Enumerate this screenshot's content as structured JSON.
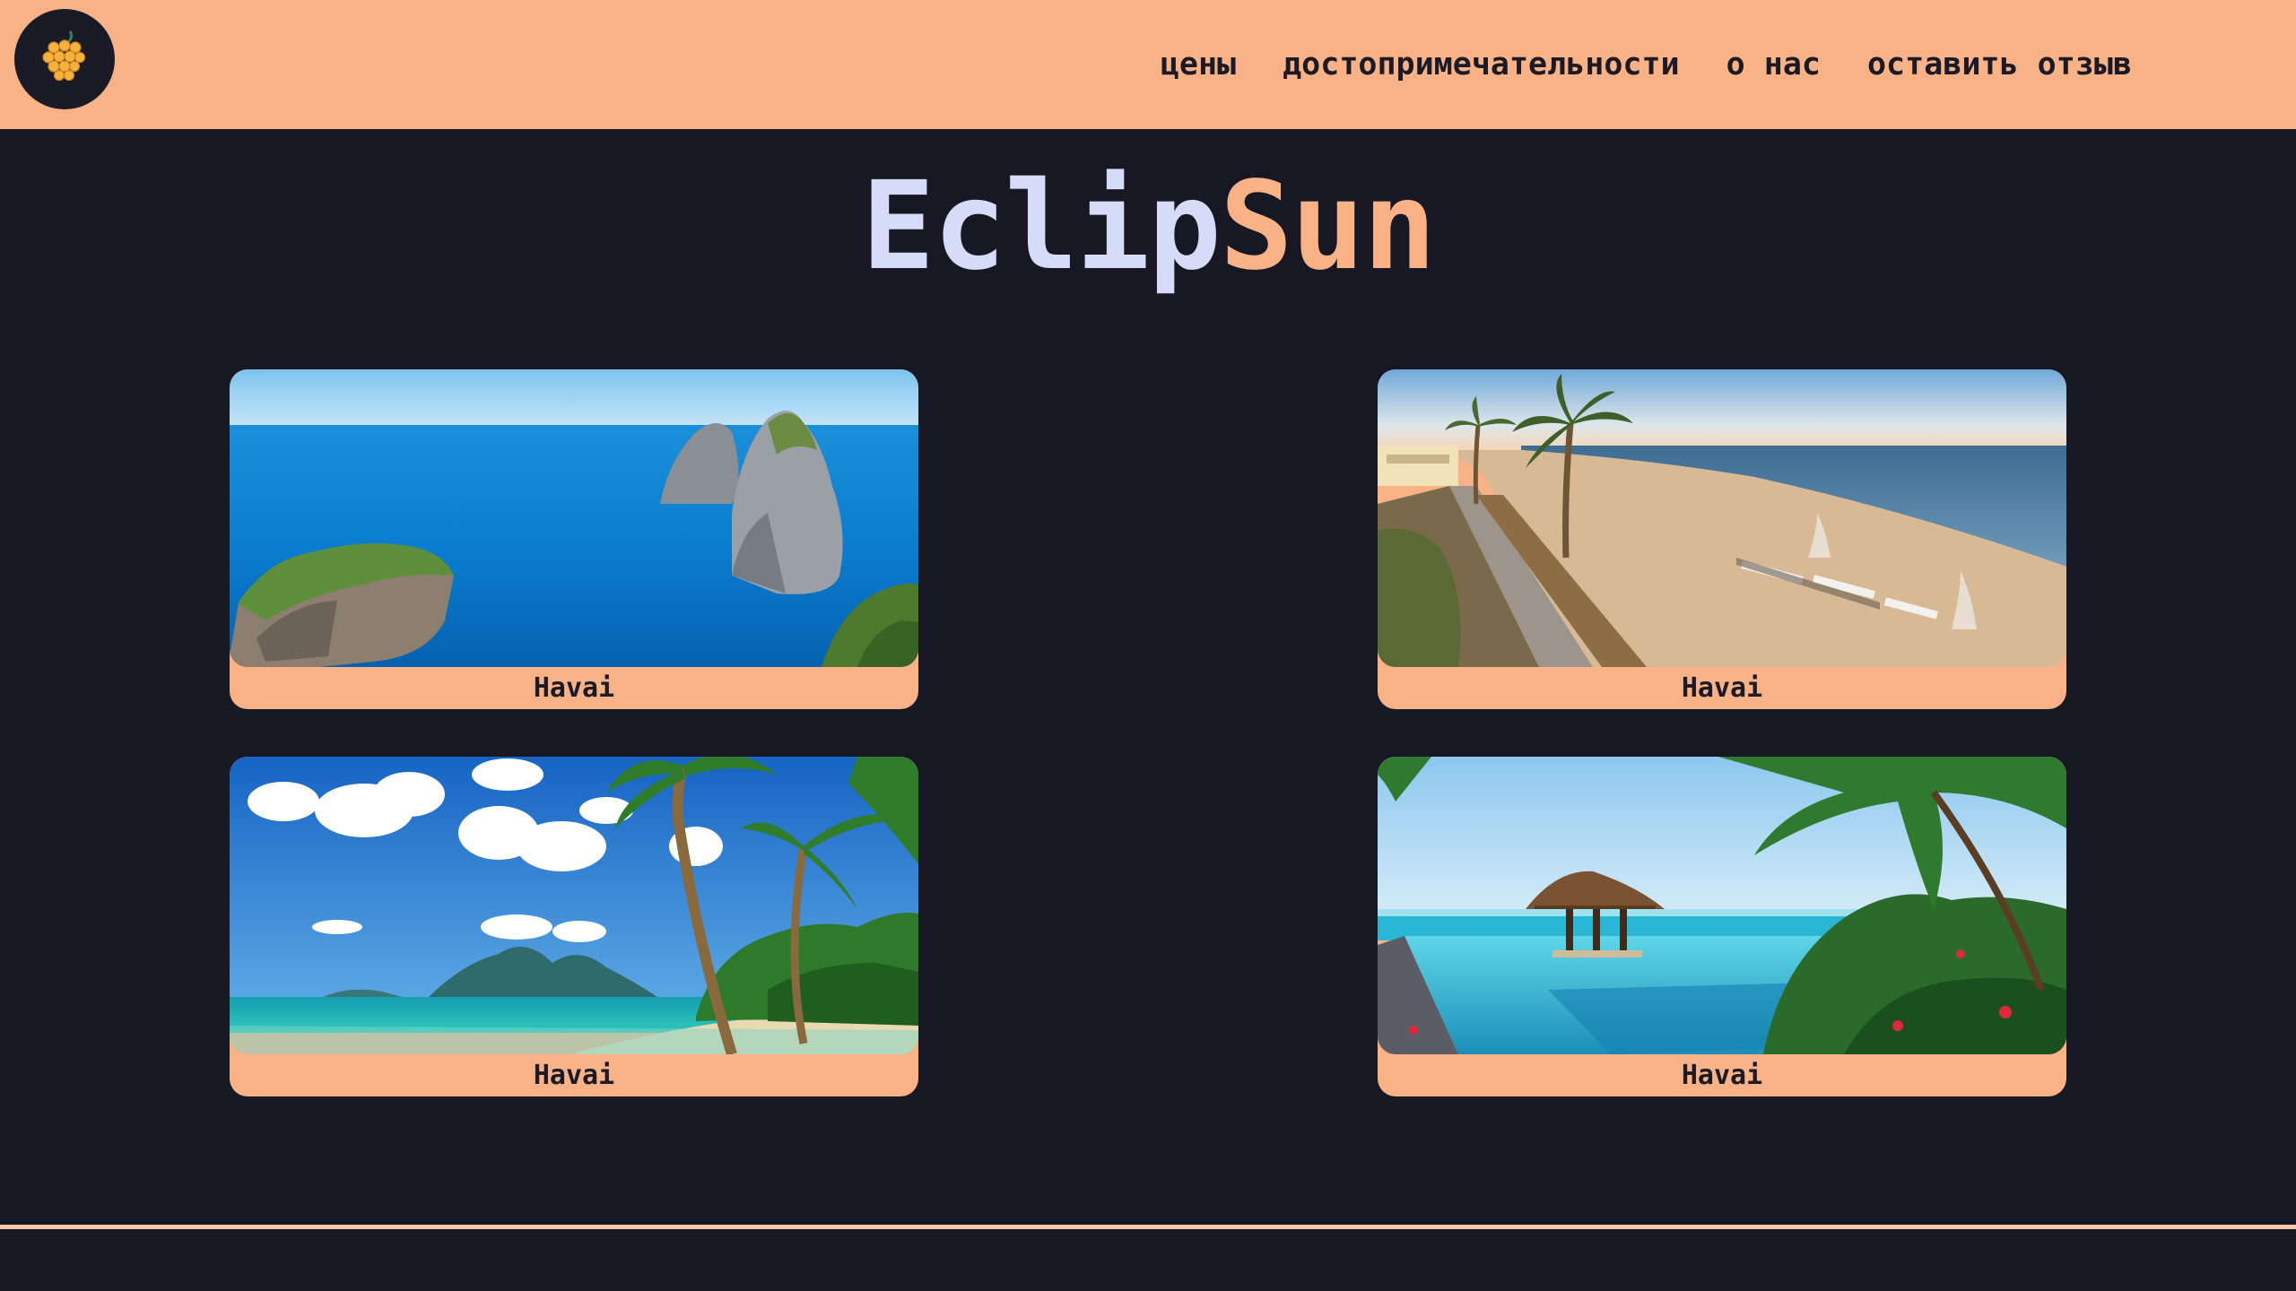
{
  "brand": {
    "title_part1": "Eclip",
    "title_part2": "Sun",
    "logo_icon": "golden-grapes-icon"
  },
  "nav": {
    "items": [
      {
        "label": "цены"
      },
      {
        "label": "достопримечательности"
      },
      {
        "label": "о нас"
      },
      {
        "label": "оставить отзыв"
      }
    ]
  },
  "cards": [
    {
      "caption": "Havai",
      "image": "sea-cliffs-photo"
    },
    {
      "caption": "Havai",
      "image": "sandy-beach-promenade-photo"
    },
    {
      "caption": "Havai",
      "image": "palm-beach-islands-photo"
    },
    {
      "caption": "Havai",
      "image": "infinity-pool-resort-photo"
    }
  ],
  "colors": {
    "accent": "#f8b286",
    "background": "#181824",
    "title_light": "#d6dcf7",
    "text_dark": "#1a1b26"
  }
}
